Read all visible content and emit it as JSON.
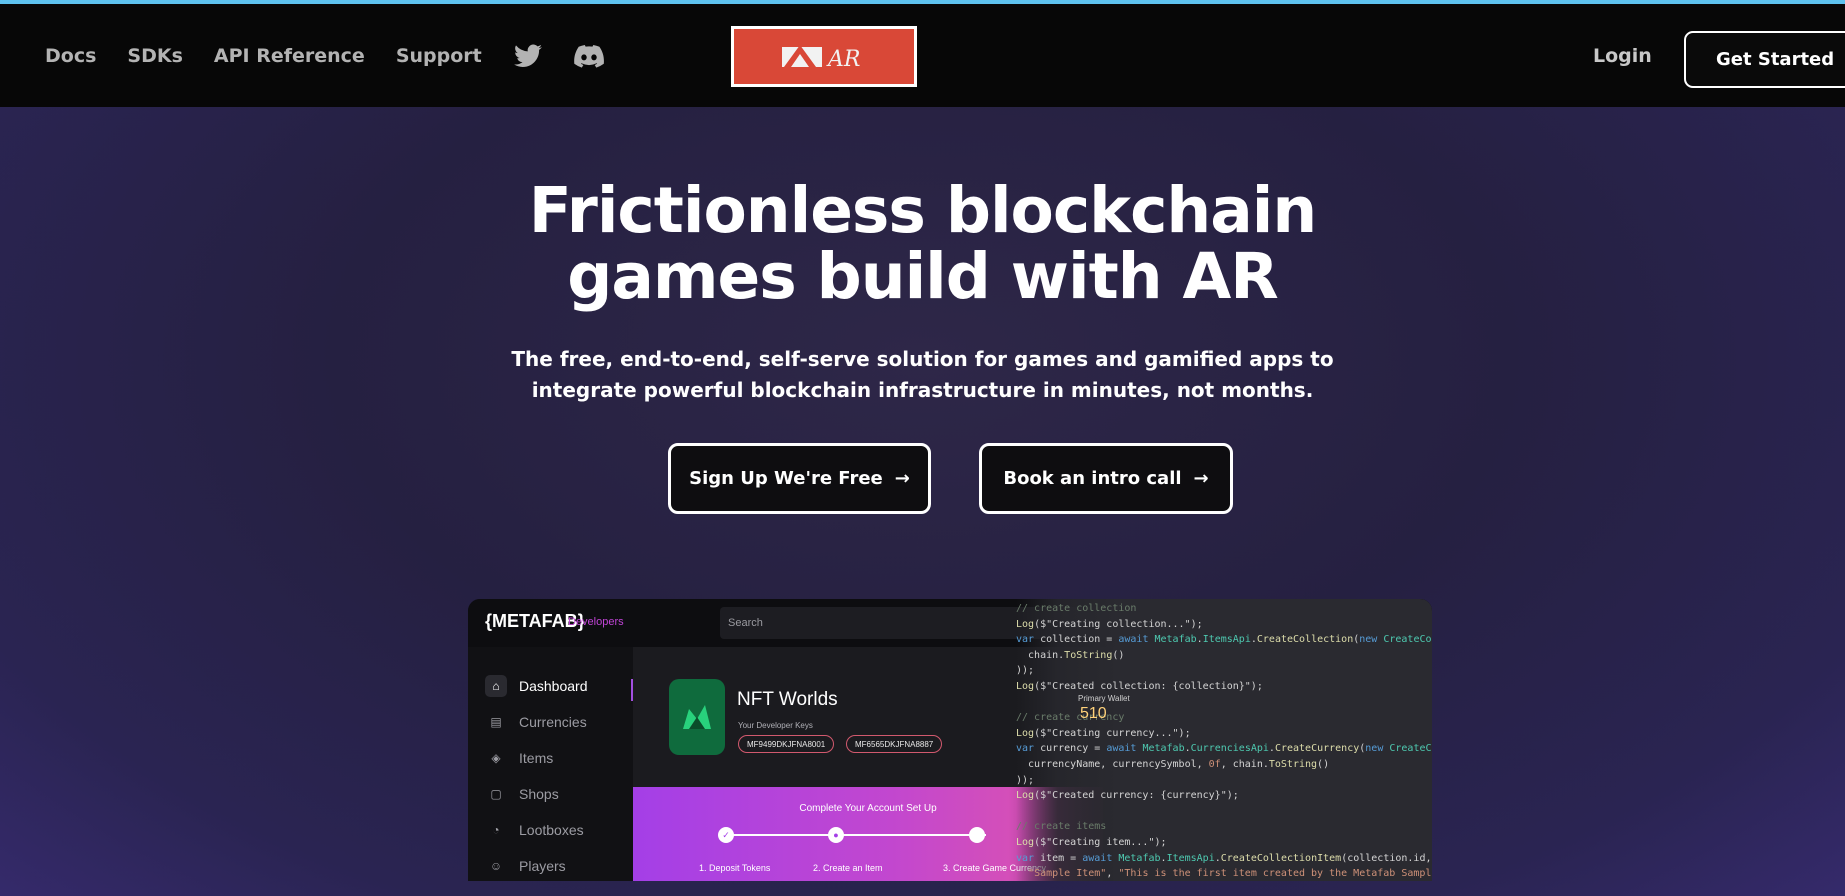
{
  "nav": {
    "links": [
      "Docs",
      "SDKs",
      "API Reference",
      "Support"
    ],
    "icons": [
      "twitter-icon",
      "discord-icon"
    ],
    "logo_text": "AR",
    "login": "Login",
    "get_started": "Get Started"
  },
  "hero": {
    "title_line1": "Frictionless blockchain",
    "title_line2": "games build with AR",
    "subtitle_line1": "The free, end-to-end, self-serve solution for games and gamified apps to",
    "subtitle_line2": "integrate powerful blockchain infrastructure in minutes, not months.",
    "cta_primary": "Sign Up We're Free",
    "cta_secondary": "Book an intro call"
  },
  "preview": {
    "brand": "METAFAB",
    "brand_tag": "Developers",
    "search_placeholder": "Search",
    "sidebar": [
      {
        "label": "Dashboard",
        "icon": "home-icon"
      },
      {
        "label": "Currencies",
        "icon": "currency-icon"
      },
      {
        "label": "Items",
        "icon": "layers-icon"
      },
      {
        "label": "Shops",
        "icon": "shop-icon"
      },
      {
        "label": "Lootboxes",
        "icon": "lootbox-icon"
      },
      {
        "label": "Players",
        "icon": "user-icon"
      }
    ],
    "project_name": "NFT Worlds",
    "keys_label": "Your Developer Keys",
    "key1": "MF9499DKJFNA8001",
    "key2": "MF6565DKJFNA8887",
    "wallet_label": "Primary Wallet",
    "wallet_value": "510",
    "setup_title": "Complete Your Account Set Up",
    "steps": [
      "1. Deposit Tokens",
      "2. Create an Item",
      "3. Create Game Currency"
    ]
  },
  "colors": {
    "accent_blue": "#5ec2ef",
    "logo_red": "#d94837",
    "setup_purple": "#a43fe7"
  }
}
